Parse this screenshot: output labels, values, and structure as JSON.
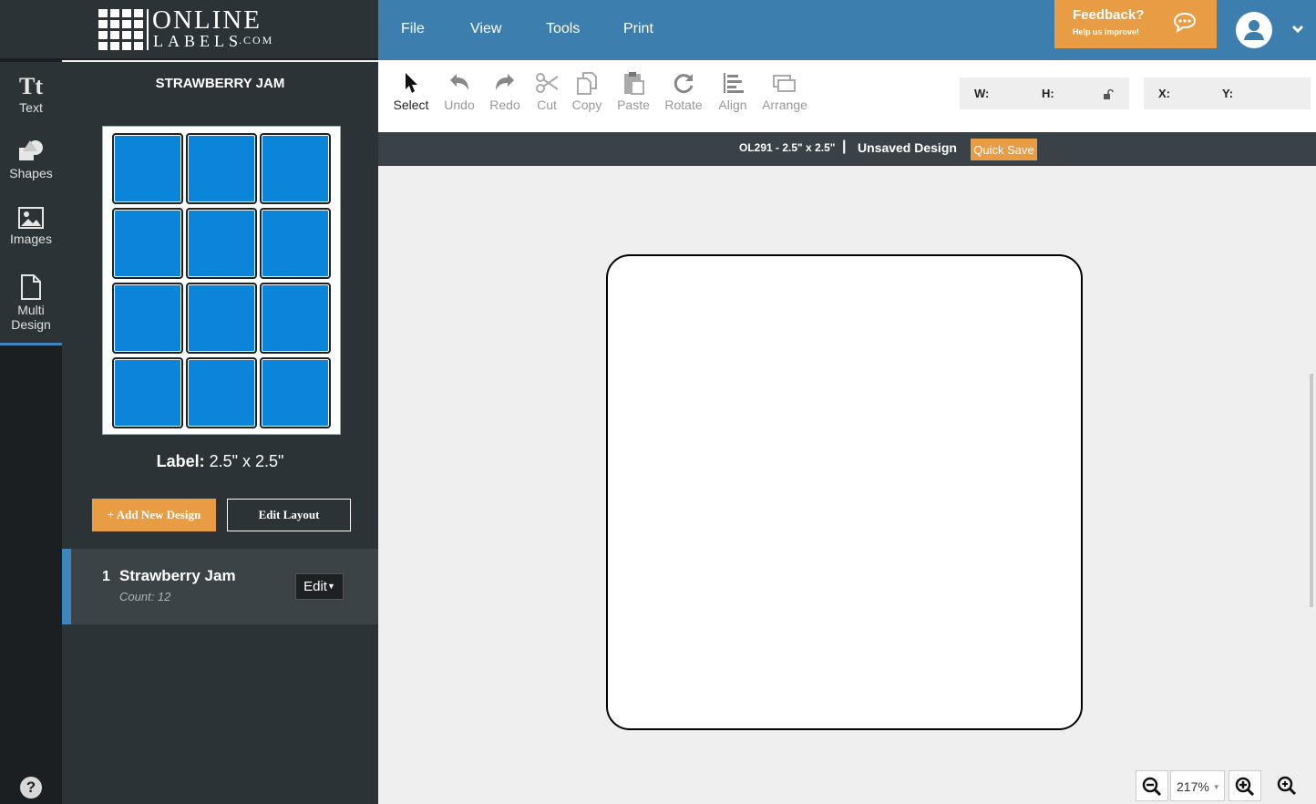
{
  "brand": {
    "line1": "ONLINE",
    "line2": "LABELS",
    "suffix": ".COM"
  },
  "rail": {
    "items": [
      {
        "label": "Text",
        "icon": "text-icon"
      },
      {
        "label": "Shapes",
        "icon": "shapes-icon"
      },
      {
        "label": "Images",
        "icon": "images-icon"
      },
      {
        "label": "Multi Design",
        "icon": "document-icon"
      }
    ],
    "help": "?"
  },
  "panel": {
    "title": "STRAWBERRY JAM",
    "label_prefix": "Label:",
    "label_value": " 2.5\" x 2.5\"",
    "add_button": "+ Add New Design",
    "edit_layout_button": "Edit Layout",
    "designs": [
      {
        "number": "1",
        "name": "Strawberry Jam",
        "count": "Count: 12",
        "edit": "Edit"
      }
    ]
  },
  "menu": {
    "items": [
      "File",
      "View",
      "Tools",
      "Print"
    ]
  },
  "feedback": {
    "title": "Feedback?",
    "subtitle": "Help us improve!"
  },
  "toolbar": {
    "tools": [
      "Select",
      "Undo",
      "Redo",
      "Cut",
      "Copy",
      "Paste",
      "Rotate",
      "Align",
      "Arrange"
    ],
    "w_label": "W:",
    "h_label": "H:",
    "x_label": "X:",
    "y_label": "Y:"
  },
  "status": {
    "sku": "OL291 - 2.5\" x 2.5\"",
    "separator": "|",
    "design_name": "Unsaved Design",
    "quick_save": "Quick Save"
  },
  "zoom": {
    "value": "217%"
  },
  "colors": {
    "accent": "#3c7fae",
    "orange": "#e89d45",
    "cell_blue": "#0a85d9",
    "panel": "#2c3337"
  }
}
